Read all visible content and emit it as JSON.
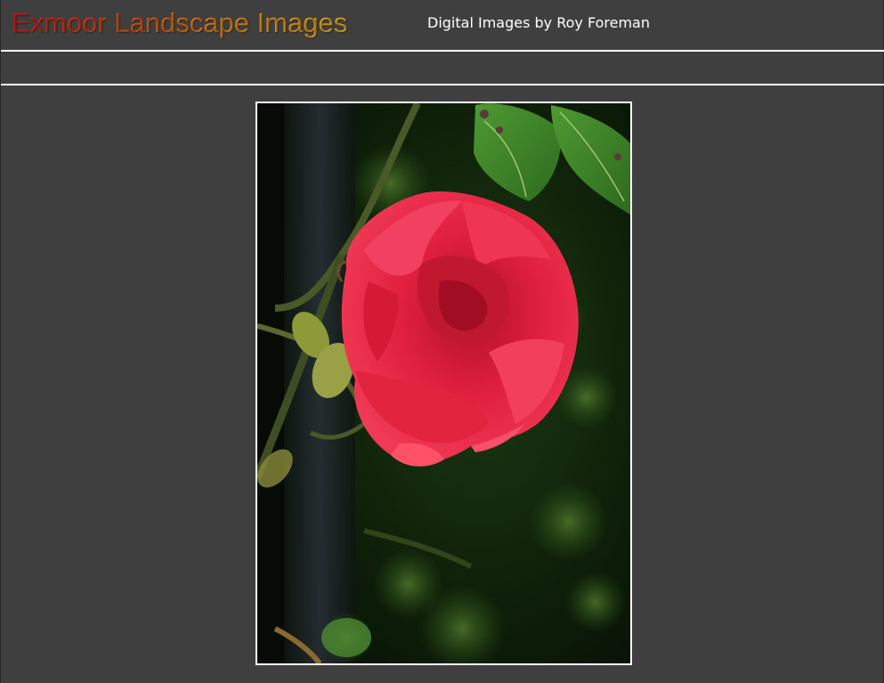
{
  "header": {
    "title": "Exmoor Landscape Images",
    "subtitle": "Digital Images by Roy Foreman"
  },
  "photo": {
    "subject": "red-rose-icon"
  },
  "colors": {
    "background": "#3f3f3f",
    "divider": "#ffffff",
    "title_gradient_start": "#d0181a",
    "title_gradient_end": "#f0b41e",
    "subtitle_text": "#ffffff"
  }
}
